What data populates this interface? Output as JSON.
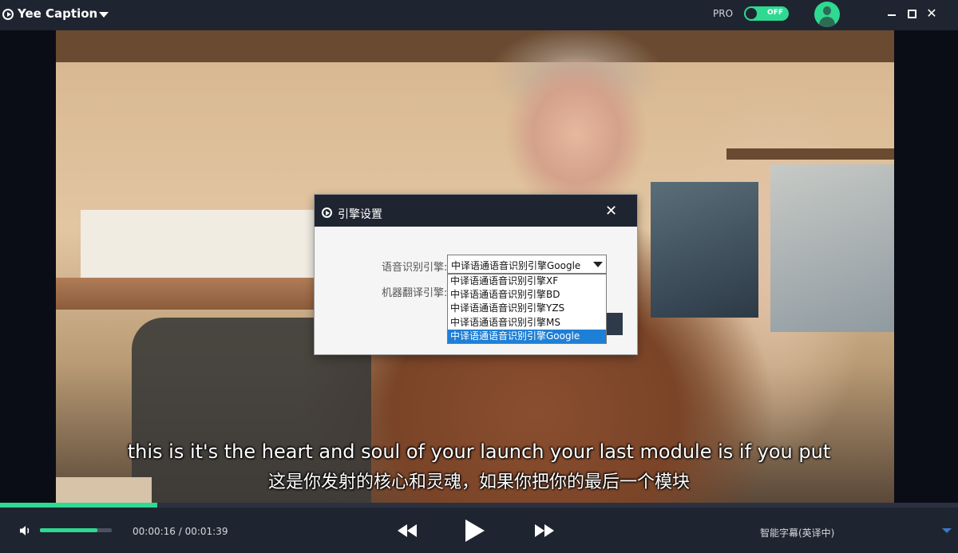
{
  "app": {
    "title": "Yee Caption"
  },
  "header": {
    "pro_label": "PRO",
    "toggle_label": "OFF"
  },
  "video": {
    "subtitle_en": "this is it's the heart and soul of your launch your last module is if you put",
    "subtitle_zh": "这是你发射的核心和灵魂，如果你把你的最后一个模块"
  },
  "player": {
    "current_time": "00:00:16",
    "separator": " / ",
    "total_time": "00:01:39",
    "progress": 0.164,
    "volume": 0.8,
    "mode_label": "智能字幕(英译中)"
  },
  "dialog": {
    "title": "引擎设置",
    "speech_label": "语音识别引擎:",
    "translate_label": "机器翻译引擎:",
    "speech_value": "中译语通语音识别引擎Google",
    "options": [
      "中译语通语音识别引擎XF",
      "中译语通语音识别引擎BD",
      "中译语通语音识别引擎YZS",
      "中译语通语音识别引擎MS",
      "中译语通语音识别引擎Google"
    ],
    "selected_index": 4
  }
}
